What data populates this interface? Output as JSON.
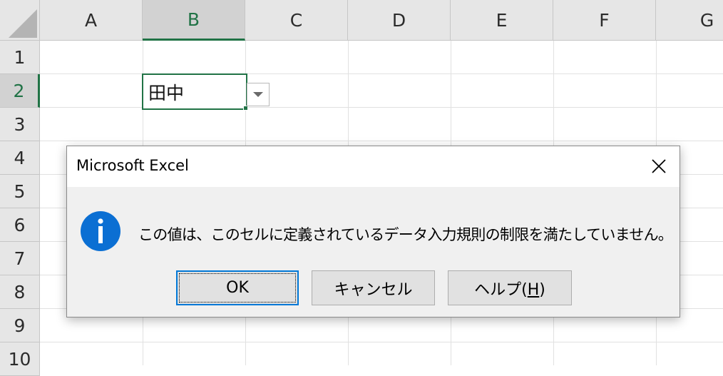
{
  "spreadsheet": {
    "columns": [
      "A",
      "B",
      "C",
      "D",
      "E",
      "F",
      "G"
    ],
    "rows": [
      "1",
      "2",
      "3",
      "4",
      "5",
      "6",
      "7",
      "8",
      "9",
      "10"
    ],
    "active_cell": {
      "column": "B",
      "row": "2",
      "value": "田中"
    },
    "accent_color": "#217346"
  },
  "dialog": {
    "title": "Microsoft Excel",
    "message": "この値は、このセルに定義されているデータ入力規則の制限を満たしていません。",
    "icon": "info-icon",
    "buttons": {
      "ok": "OK",
      "cancel": "キャンセル",
      "help_prefix": "ヘルプ(",
      "help_key": "H",
      "help_suffix": ")"
    },
    "default_button_border": "#0078d7"
  }
}
